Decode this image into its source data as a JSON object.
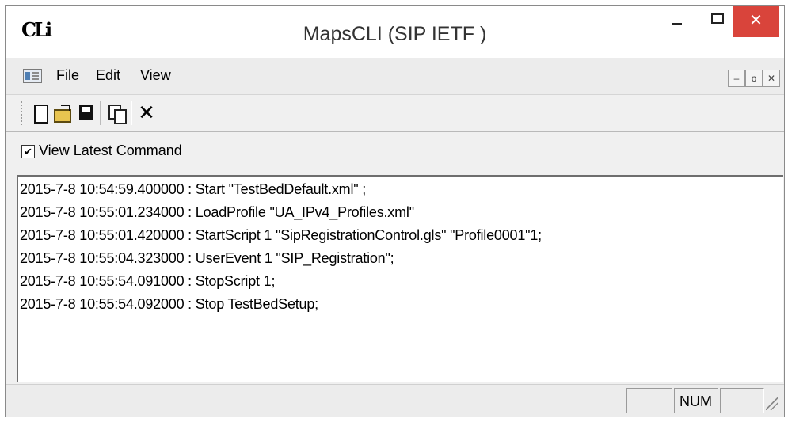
{
  "window": {
    "title": "MapsCLI  (SIP IETF )",
    "logo_text": "CLi",
    "close_symbol": "✕",
    "accent_close_color": "#d9443b"
  },
  "menu": {
    "items": [
      {
        "label": "File"
      },
      {
        "label": "Edit"
      },
      {
        "label": "View"
      }
    ],
    "mdi_buttons": [
      "–",
      "ɒ",
      "✕"
    ]
  },
  "toolbar": {
    "tools": [
      {
        "icon": "new-file-icon"
      },
      {
        "icon": "open-folder-icon"
      },
      {
        "icon": "save-icon"
      },
      {
        "icon": "copy-icon"
      },
      {
        "icon": "delete-icon",
        "symbol": "✕"
      }
    ]
  },
  "options": {
    "view_latest_label": "View Latest Command",
    "view_latest_checked": true,
    "check_symbol": "✔"
  },
  "log": {
    "lines": [
      "2015-7-8 10:54:59.400000 : Start \"TestBedDefault.xml\" ;",
      "2015-7-8 10:55:01.234000 : LoadProfile \"UA_IPv4_Profiles.xml\"",
      "2015-7-8 10:55:01.420000 : StartScript 1 \"SipRegistrationControl.gls\" \"Profile0001\"1;",
      "2015-7-8 10:55:04.323000 : UserEvent 1 \"SIP_Registration\";",
      "2015-7-8 10:55:54.091000 : StopScript 1;",
      "2015-7-8 10:55:54.092000 : Stop TestBedSetup;"
    ]
  },
  "status": {
    "panes": [
      "",
      "NUM",
      ""
    ]
  }
}
